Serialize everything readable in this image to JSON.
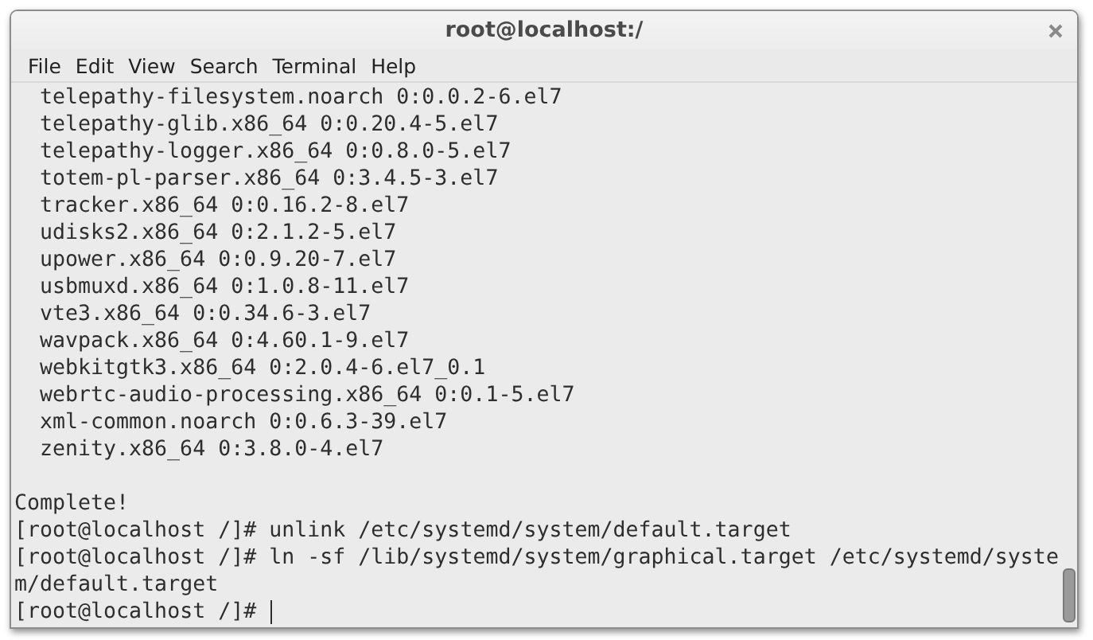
{
  "window": {
    "title": "root@localhost:/"
  },
  "menu": [
    "File",
    "Edit",
    "View",
    "Search",
    "Terminal",
    "Help"
  ],
  "terminal": {
    "packages": [
      "telepathy-filesystem.noarch 0:0.0.2-6.el7",
      "telepathy-glib.x86_64 0:0.20.4-5.el7",
      "telepathy-logger.x86_64 0:0.8.0-5.el7",
      "totem-pl-parser.x86_64 0:3.4.5-3.el7",
      "tracker.x86_64 0:0.16.2-8.el7",
      "udisks2.x86_64 0:2.1.2-5.el7",
      "upower.x86_64 0:0.9.20-7.el7",
      "usbmuxd.x86_64 0:1.0.8-11.el7",
      "vte3.x86_64 0:0.34.6-3.el7",
      "wavpack.x86_64 0:4.60.1-9.el7",
      "webkitgtk3.x86_64 0:2.0.4-6.el7_0.1",
      "webrtc-audio-processing.x86_64 0:0.1-5.el7",
      "xml-common.noarch 0:0.6.3-39.el7",
      "zenity.x86_64 0:3.8.0-4.el7"
    ],
    "lines": [
      {
        "text": "Complete!",
        "cursor": false
      },
      {
        "text": "[root@localhost /]# unlink /etc/systemd/system/default.target",
        "cursor": false
      },
      {
        "text": "[root@localhost /]# ln -sf /lib/systemd/system/graphical.target /etc/systemd/syste",
        "cursor": false
      },
      {
        "text": "m/default.target",
        "cursor": false
      },
      {
        "text": "[root@localhost /]# ",
        "cursor": true
      }
    ]
  }
}
